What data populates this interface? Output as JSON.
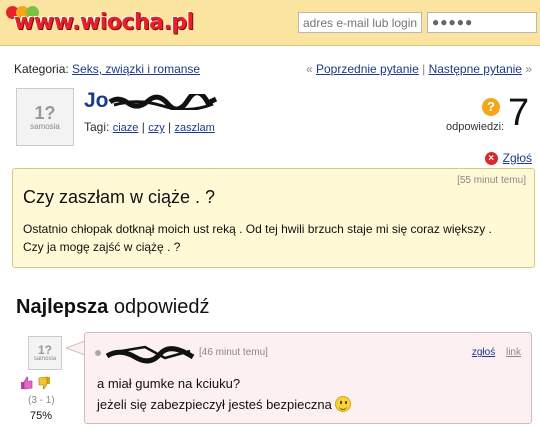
{
  "header": {
    "logo": "www.wiocha.pl",
    "login_placeholder": "adres e-mail lub login",
    "password_value": "●●●●●"
  },
  "breadcrumb": {
    "label": "Kategoria:",
    "category": "Seks, związki i romanse"
  },
  "nav": {
    "prev": "Poprzednie pytanie",
    "next": "Następne pytanie",
    "prev_arrow": "«",
    "next_arrow": "»",
    "separator": "|"
  },
  "question": {
    "author": "Jo",
    "tags_label": "Tagi:",
    "tags": [
      "ciaze",
      "czy",
      "zaszlam"
    ],
    "answers_label": "odpowiedzi:",
    "answers_count": "7",
    "report": "Zgłoś",
    "time": "[55 minut temu]",
    "title": "Czy zaszłam w ciąże . ?",
    "body": "Ostatnio chłopak dotknął moich ust reką . Od tej hwili brzuch staje mi się coraz większy . Czy ja mogę zajść w ciążę . ?"
  },
  "avatar": {
    "label": "samosia"
  },
  "best_answer": {
    "heading_bold": "Najlepsza",
    "heading_rest": "odpowiedź",
    "time": "[46 minut temu]",
    "report": "zgłoś",
    "link": "link",
    "line1": "a miał gumke na kciuku?",
    "line2": "jeżeli się zabezpieczył jesteś bezpieczna",
    "votes": "(3 - 1)",
    "percent": "75%"
  },
  "colors": {
    "topbar": "#fbe3a0",
    "link": "#1a3a8a",
    "question_bg": "#fff9d6",
    "answer_bg": "#fdf0f1",
    "logo_red": "#e8202a"
  }
}
